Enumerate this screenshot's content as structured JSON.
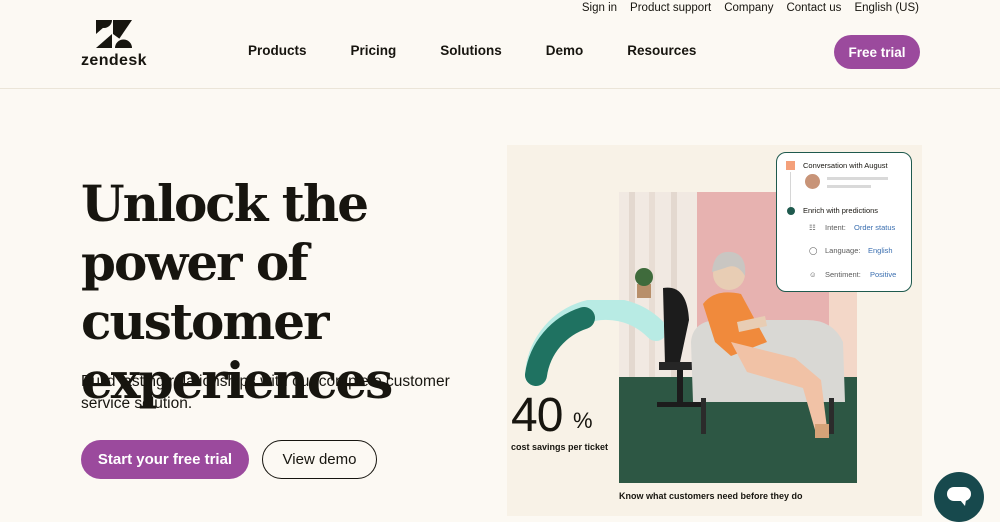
{
  "utility_nav": [
    "Sign in",
    "Product support",
    "Company",
    "Contact us",
    "English (US)"
  ],
  "brand": {
    "name": "zendesk",
    "accent": "#9b4a9d",
    "dark_green": "#17494d"
  },
  "main_nav": [
    "Products",
    "Pricing",
    "Solutions",
    "Demo",
    "Resources"
  ],
  "header": {
    "cta": "Free trial"
  },
  "hero": {
    "headline": "Unlock the power of customer experiences",
    "subhead": "Build lasting relationships with our complete customer service solution.",
    "primary_cta": "Start your free trial",
    "secondary_cta": "View demo"
  },
  "stat": {
    "value": "40",
    "unit": "%",
    "label": "cost savings per ticket"
  },
  "photo_caption": "Know what customers need before they do",
  "card": {
    "title": "Conversation with August",
    "section": "Enrich with predictions",
    "intent_label": "Intent:",
    "intent_value": "Order status",
    "language_label": "Language:",
    "language_value": "English",
    "sentiment_label": "Sentiment:",
    "sentiment_value": "Positive"
  },
  "icons": {
    "chat": "chat-bubble-icon",
    "logo": "zendesk-logo-icon"
  }
}
